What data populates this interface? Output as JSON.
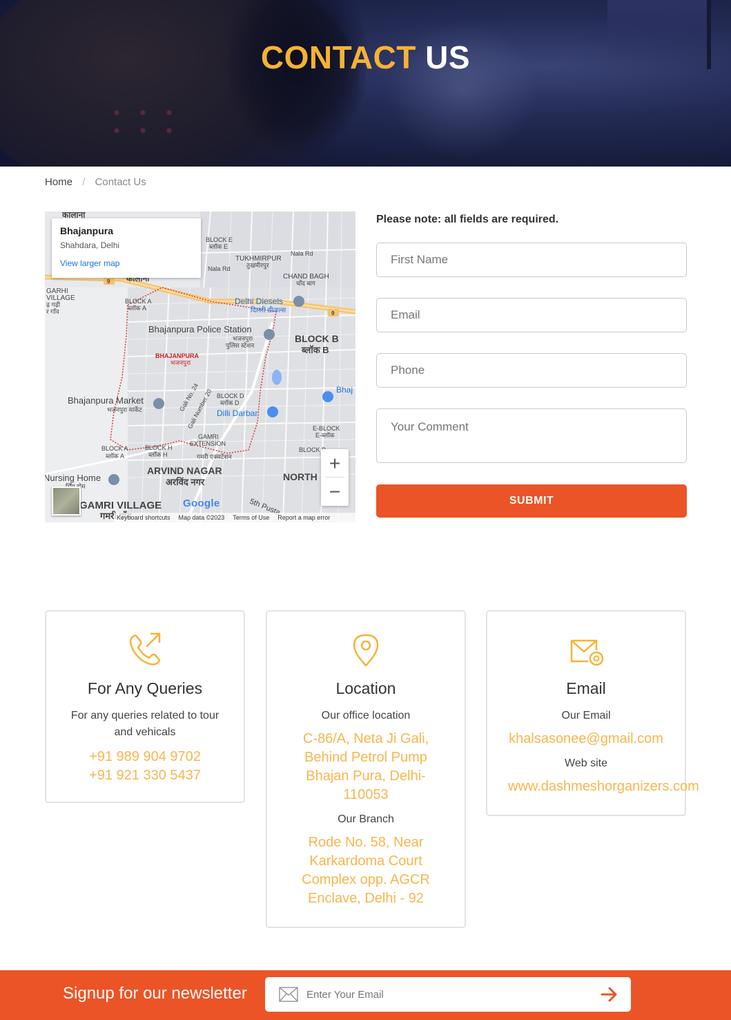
{
  "hero": {
    "title_part1": "CONTACT",
    "title_part2": "US"
  },
  "breadcrumb": {
    "home": "Home",
    "separator": "/",
    "current": "Contact Us"
  },
  "map": {
    "card_title": "Bhajanpura",
    "card_subtitle": "Shahdara, Delhi",
    "card_link": "View larger map",
    "zoom_in": "+",
    "zoom_out": "−",
    "brand": "Google",
    "footer": [
      "Keyboard shortcuts",
      "Map data ©2023",
      "Terms of Use",
      "Report a map error"
    ],
    "labels": {
      "kalana": "कालाना",
      "block_e": "BLOCK E",
      "block_e_hi": "ब्लॉक E",
      "nala_rd": "Nala Rd",
      "nala_rd2": "Nala Rd",
      "tukhmirpur": "TUKHMIRPUR",
      "tukhmirpur_hi": "तुखमीरपुर",
      "chand_bagh": "CHAND BAGH",
      "chand_bagh_hi": "चाँद बाग",
      "garhi": "GARHI",
      "village": "VILLAGE",
      "garhi_hi": "ढ़ गढ़ी",
      "gaon": "र गाँव",
      "block_a": "BLOCK A",
      "block_a_hi": "ब्लॉक A",
      "delhi_diesels": "Delhi Diesels",
      "delhi_diesels_hi": "दिल्ली डीजल्स",
      "police": "Bhajanpura Police Station",
      "police_hi1": "भजनपुरा",
      "police_hi2": "पुलिस स्टेशन",
      "block_b": "BLOCK B",
      "block_b_hi": "ब्लॉक B",
      "bhajanpura": "BHAJANPURA",
      "bhajanpura_hi": "भजनपुरा",
      "bhaj": "Bhaj",
      "market": "Bhajanpura Market",
      "market_hi": "भजनपुरा मार्केट",
      "gali24": "Gali No. 24",
      "gali20": "Gali Number 20",
      "block_d": "BLOCK D",
      "block_d_hi": "ब्लॉक D",
      "dilli_darbar": "Dilli Darbar",
      "e_block": "E-BLOCK",
      "e_block_hi": "E-ब्लॉक",
      "gamri": "GAMRI",
      "extension": "EXTENSION",
      "gamri_ext_hi": "गमरी एक्सटेंशन",
      "block_h": "BLOCK H",
      "block_h_hi": "ब्लॉक H",
      "block_a2": "BLOCK A",
      "block_a2_hi": "ब्लॉक A",
      "block_p": "BLOCK P",
      "arvind": "ARVIND NAGAR",
      "arvind_hi": "अरविंद नगर",
      "north": "NORTH",
      "nursing": "Nursing Home",
      "nursing_hi": "र्सिंग होम",
      "gamri_village": "GAMRI VILLAGE",
      "gamri_village_hi": "गमरी गाँव",
      "pusta": "5th Pusta",
      "road9": "9"
    }
  },
  "form": {
    "note": "Please note: all fields are required.",
    "first_name_placeholder": "First Name",
    "email_placeholder": "Email",
    "phone_placeholder": "Phone",
    "comment_placeholder": "Your Comment",
    "submit_label": "SUBMIT"
  },
  "cards": {
    "queries": {
      "icon": "phone-call-icon",
      "title": "For Any Queries",
      "subtitle": "For any queries related to tour and vehicals",
      "phone1": "+91 989 904 9702",
      "phone2": "+91 921 330 5437"
    },
    "location": {
      "icon": "location-pin-icon",
      "title": "Location",
      "subtitle": "Our office location",
      "office_line1": "C-86/A, Neta Ji Gali,",
      "office_line2": "Behind Petrol Pump",
      "office_line3": "Bhajan Pura, Delhi-",
      "office_line4": "110053",
      "branch_label": "Our Branch",
      "branch_line1": "Rode No. 58, Near",
      "branch_line2": "Karkardoma Court",
      "branch_line3": "Complex opp. AGCR",
      "branch_line4": "Enclave, Delhi - 92"
    },
    "email": {
      "icon": "email-at-icon",
      "title": "Email",
      "subtitle": "Our Email",
      "email": "khalsasonee@gmail.com",
      "website_label": "Web site",
      "website": "www.dashmeshorganizers.com"
    }
  },
  "newsletter": {
    "label": "Signup for our newsletter",
    "placeholder": "Enter Your Email"
  },
  "colors": {
    "accent_orange": "#eb5426",
    "highlight_yellow": "#f7b234",
    "link_yellow": "#f7b64e"
  }
}
